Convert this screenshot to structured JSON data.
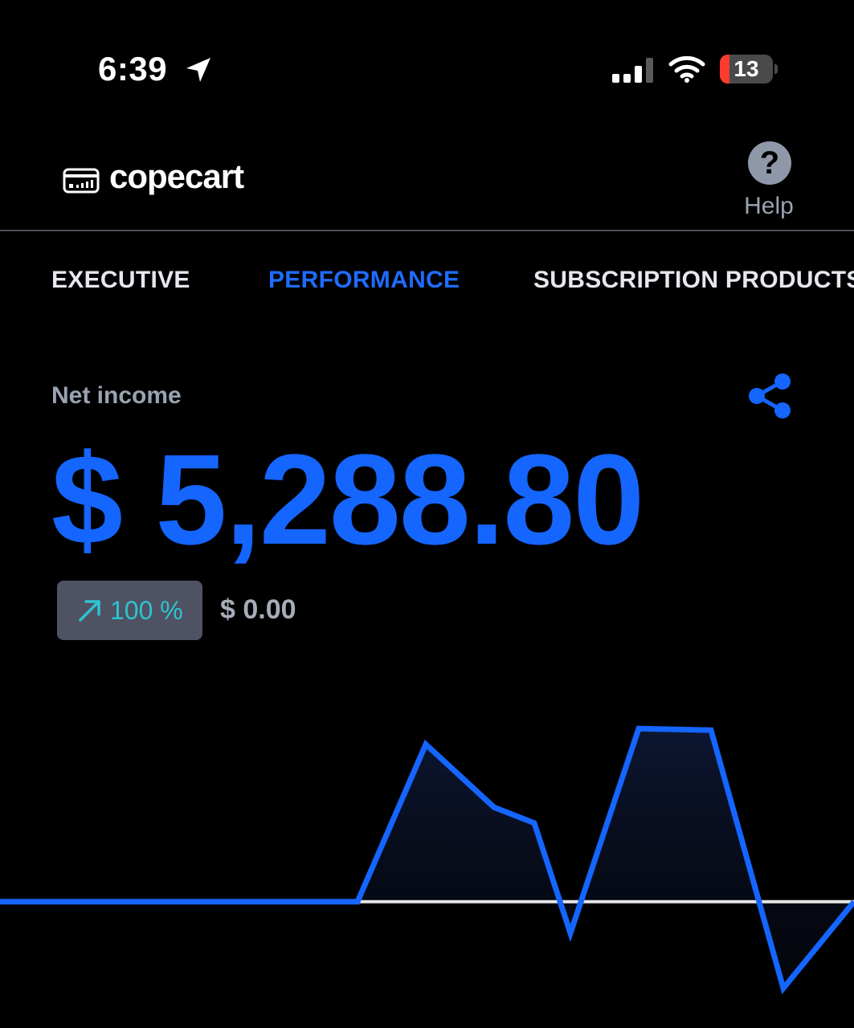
{
  "status_bar": {
    "time": "6:39",
    "battery_level": "13",
    "icons": [
      "location-arrow-icon",
      "cellular-signal-icon",
      "wifi-icon",
      "battery-icon"
    ]
  },
  "header": {
    "app_name": "copecart",
    "help_label": "Help",
    "help_symbol": "?"
  },
  "tabs": [
    {
      "label": "EXECUTIVE",
      "active": false
    },
    {
      "label": "PERFORMANCE",
      "active": true
    },
    {
      "label": "SUBSCRIPTION PRODUCTS",
      "active": false
    }
  ],
  "metric": {
    "label": "Net income",
    "value": "$ 5,288.80",
    "change_percent": "100 %",
    "previous_value": "$ 0.00"
  },
  "colors": {
    "accent": "#1565ff",
    "background": "#000000",
    "badge_bg": "#4f5263",
    "change_positive": "#2ec3d2",
    "baseline": "#e6e6e6"
  },
  "chart_data": {
    "type": "area",
    "values": [
      0,
      0,
      0,
      0,
      0,
      1,
      0.6,
      0.5,
      -0.2,
      1.1,
      1.09,
      -0.55,
      0
    ],
    "baseline": 0,
    "ylim": [
      -0.7,
      1.3
    ],
    "grid": false,
    "legend": "none"
  }
}
